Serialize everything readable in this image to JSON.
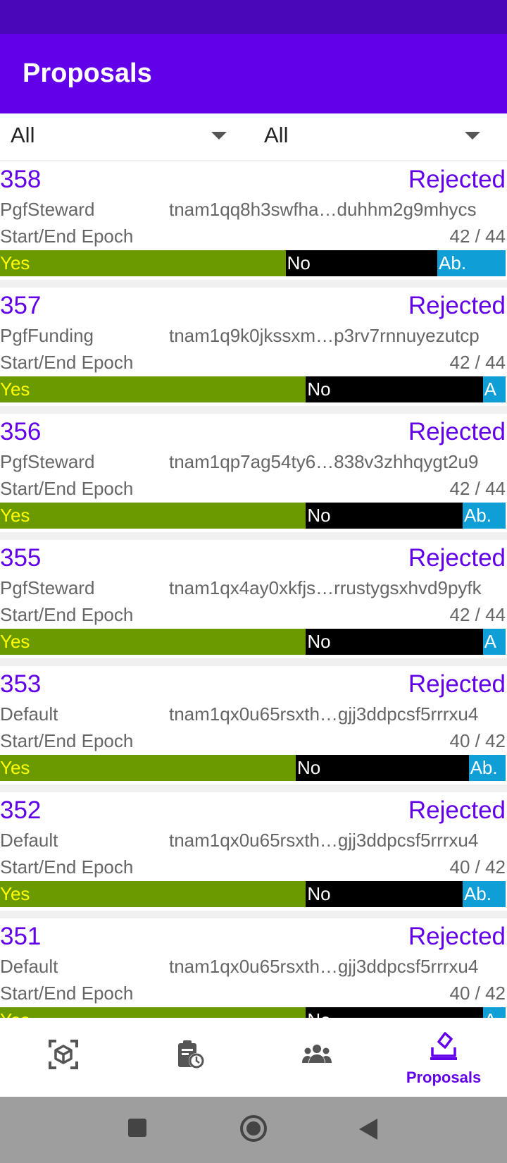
{
  "app": {
    "title": "Proposals"
  },
  "filters": [
    {
      "value": "All"
    },
    {
      "value": "All"
    }
  ],
  "proposals": [
    {
      "id": "358",
      "status": "Rejected",
      "type": "PgfSteward",
      "author": "tnam1qq8h3swfha…duhhm2g9mhycs",
      "epoch_label": "Start/End Epoch",
      "epoch": "42 / 44",
      "yes_label": "Yes",
      "no_label": "No",
      "abstain_label": "Ab.",
      "yes": 56.5,
      "no": 30.0,
      "abstain": 13.5
    },
    {
      "id": "357",
      "status": "Rejected",
      "type": "PgfFunding",
      "author": "tnam1q9k0jkssxm…p3rv7rnnuyezutcp",
      "epoch_label": "Start/End Epoch",
      "epoch": "42 / 44",
      "yes_label": "Yes",
      "no_label": "No",
      "abstain_label": "A",
      "yes": 60.5,
      "no": 35.0,
      "abstain": 4.5
    },
    {
      "id": "356",
      "status": "Rejected",
      "type": "PgfSteward",
      "author": "tnam1qp7ag54ty6…838v3zhhqygt2u9",
      "epoch_label": "Start/End Epoch",
      "epoch": "42 / 44",
      "yes_label": "Yes",
      "no_label": "No",
      "abstain_label": "Ab.",
      "yes": 60.5,
      "no": 31.0,
      "abstain": 8.5
    },
    {
      "id": "355",
      "status": "Rejected",
      "type": "PgfSteward",
      "author": "tnam1qx4ay0xkfjs…rrustygsxhvd9pyfk",
      "epoch_label": "Start/End Epoch",
      "epoch": "42 / 44",
      "yes_label": "Yes",
      "no_label": "No",
      "abstain_label": "A",
      "yes": 60.5,
      "no": 35.0,
      "abstain": 4.5
    },
    {
      "id": "353",
      "status": "Rejected",
      "type": "Default",
      "author": "tnam1qx0u65rsxth…gjj3ddpcsf5rrrxu4",
      "epoch_label": "Start/End Epoch",
      "epoch": "40 / 42",
      "yes_label": "Yes",
      "no_label": "No",
      "abstain_label": "Ab.",
      "yes": 58.5,
      "no": 34.2,
      "abstain": 7.3
    },
    {
      "id": "352",
      "status": "Rejected",
      "type": "Default",
      "author": "tnam1qx0u65rsxth…gjj3ddpcsf5rrrxu4",
      "epoch_label": "Start/End Epoch",
      "epoch": "40 / 42",
      "yes_label": "Yes",
      "no_label": "No",
      "abstain_label": "Ab.",
      "yes": 60.5,
      "no": 31.0,
      "abstain": 8.5
    },
    {
      "id": "351",
      "status": "Rejected",
      "type": "Default",
      "author": "tnam1qx0u65rsxth…gjj3ddpcsf5rrrxu4",
      "epoch_label": "Start/End Epoch",
      "epoch": "40 / 42",
      "yes_label": "Yes",
      "no_label": "No",
      "abstain_label": "A",
      "yes": 60.5,
      "no": 35.0,
      "abstain": 4.5
    }
  ],
  "bottom_nav": [
    {
      "icon": "cube-scan-icon",
      "label": ""
    },
    {
      "icon": "clipboard-clock-icon",
      "label": ""
    },
    {
      "icon": "people-icon",
      "label": ""
    },
    {
      "icon": "ballot-box-icon",
      "label": "Proposals"
    }
  ],
  "colors": {
    "status_bar": "#4a06b9",
    "app_bar": "#6200ea",
    "accent": "#6200ea",
    "yes": "#6a9a00",
    "yes_text": "#ffff00",
    "no": "#000000",
    "abstain": "#0f9ed6"
  }
}
